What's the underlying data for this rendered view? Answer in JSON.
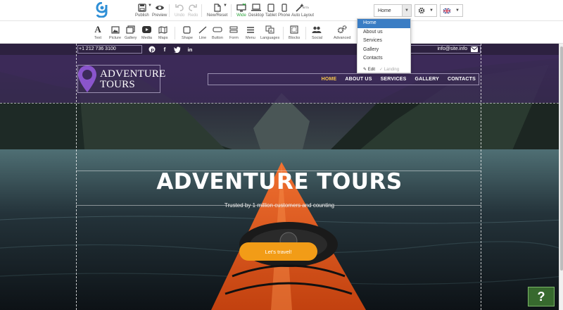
{
  "topbar": {
    "publish": "Publish",
    "preview": "Preview",
    "undo": "Undo",
    "redo": "Redo",
    "new_reset": "New/Reset",
    "wide": "Wide",
    "desktop": "Desktop",
    "tablet": "Tablet",
    "phone": "Phone",
    "auto_layout": "Auto Layout",
    "auto_layout_badge": "BETA",
    "page_select_value": "Home",
    "settings_icon": "gear-icon",
    "language_icon": "uk-flag-icon"
  },
  "toolbar2": [
    "Text",
    "Picture",
    "Gallery",
    "Media",
    "Maps",
    "Shape",
    "Line",
    "Button",
    "Form",
    "Menu",
    "Languages",
    "Blocks",
    "Social",
    "Advanced"
  ],
  "dropdown": {
    "items": [
      "Home",
      "About us",
      "Services",
      "Gallery",
      "Contacts"
    ],
    "selected": "Home",
    "edit_label": "Edit",
    "landing_label": "Landing"
  },
  "site": {
    "phone": "+1 212 736 3100",
    "email": "info@site.info",
    "social_icons": [
      "pinterest-icon",
      "facebook-icon",
      "twitter-icon",
      "linkedin-icon"
    ],
    "brand_line1": "ADVENTURE",
    "brand_line2": "TOURS",
    "nav": [
      "HOME",
      "ABOUT US",
      "SERVICES",
      "GALLERY",
      "CONTACTS"
    ],
    "hero_title": "ADVENTURE TOURS",
    "hero_subtitle": "Trusted by 1 million customers and counting",
    "cta_label": "Let's travel!"
  },
  "help_label": "?",
  "colors": {
    "purple_header": "#2d2140",
    "accent_orange": "#f29c17",
    "nav_active": "#f6c64a",
    "dropdown_selected": "#3a7dc4",
    "help_green": "#37692e"
  }
}
